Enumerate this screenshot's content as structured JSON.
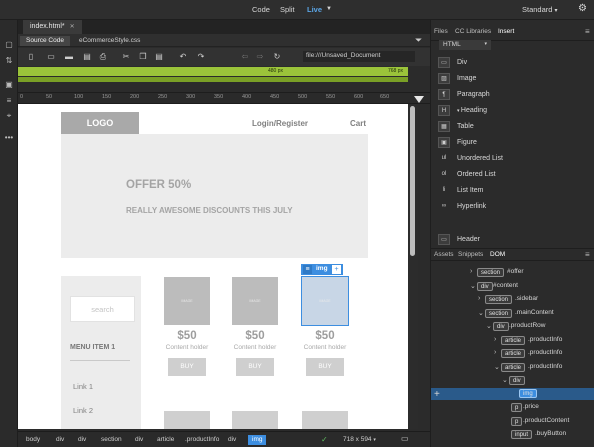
{
  "toolbar": {
    "view_modes": [
      "Code",
      "Split",
      "Live"
    ],
    "live_dropdown": "▼",
    "workspace": "Standard",
    "gear": "⚙"
  },
  "doc": {
    "tab": "index.html*",
    "related_files": [
      "Source Code",
      "eCommerceStyle.css"
    ],
    "url": "file:///Unsaved_Document"
  },
  "media_query": {
    "left_label": "480 px",
    "right_label": "768 px"
  },
  "ruler": {
    "ticks": [
      "0",
      "50",
      "100",
      "150",
      "200",
      "250",
      "300",
      "350",
      "400",
      "450",
      "500",
      "550",
      "600",
      "650"
    ]
  },
  "page": {
    "logo": "LOGO",
    "login": "Login/Register",
    "cart": "Cart",
    "offer_title": "OFFER 50%",
    "offer_subtitle": "REALLY AWESOME DISCOUNTS THIS JULY",
    "search_placeholder": "search",
    "menu_item": "MENU ITEM 1",
    "links": [
      "Link 1",
      "Link 2"
    ],
    "products": [
      {
        "img": "IMAGE",
        "price": "$50",
        "holder": "Content holder",
        "buy": "BUY"
      },
      {
        "img": "IMAGE",
        "price": "$50",
        "holder": "Content holder",
        "buy": "BUY"
      },
      {
        "img": "IMAGE",
        "price": "$50",
        "holder": "Content holder",
        "buy": "BUY"
      }
    ],
    "selected_tag": "img"
  },
  "status": {
    "breadcrumbs": [
      "body",
      "div",
      "div",
      "section",
      "div",
      "article",
      ".productInfo",
      "div",
      "img"
    ],
    "size": "718 x 594"
  },
  "panel": {
    "tabs": [
      "Files",
      "CC Libraries",
      "Insert"
    ],
    "category": "HTML",
    "insert_items": [
      {
        "icon": "div-icon",
        "label": "Div",
        "glyph": "▭"
      },
      {
        "icon": "image-icon",
        "label": "Image",
        "glyph": "▨"
      },
      {
        "icon": "paragraph-icon",
        "label": "Paragraph",
        "glyph": "¶"
      },
      {
        "icon": "heading-icon",
        "label": "Heading",
        "glyph": "H"
      },
      {
        "icon": "table-icon",
        "label": "Table",
        "glyph": "▦"
      },
      {
        "icon": "figure-icon",
        "label": "Figure",
        "glyph": "▣"
      },
      {
        "icon": "unordered-list-icon",
        "label": "Unordered List",
        "glyph": "ul"
      },
      {
        "icon": "ordered-list-icon",
        "label": "Ordered List",
        "glyph": "ol"
      },
      {
        "icon": "list-item-icon",
        "label": "List Item",
        "glyph": "li"
      },
      {
        "icon": "hyperlink-icon",
        "label": "Hyperlink",
        "glyph": "∞"
      },
      {
        "icon": "header-icon",
        "label": "Header",
        "glyph": "▭"
      }
    ],
    "bottom_tabs": [
      "Assets",
      "Snippets",
      "DOM"
    ],
    "dom_tree": [
      {
        "arrow": "›",
        "tag": "section",
        "sel": "#offer"
      },
      {
        "arrow": "⌄",
        "tag": "div",
        "sel": "#content"
      },
      {
        "arrow": "›",
        "tag": "section",
        "sel": ".sidebar"
      },
      {
        "arrow": "⌄",
        "tag": "section",
        "sel": ".mainContent"
      },
      {
        "arrow": "⌄",
        "tag": "div",
        "sel": ".productRow"
      },
      {
        "arrow": "›",
        "tag": "article",
        "sel": ".productInfo"
      },
      {
        "arrow": "›",
        "tag": "article",
        "sel": ".productInfo"
      },
      {
        "arrow": "⌄",
        "tag": "article",
        "sel": ".productInfo"
      },
      {
        "arrow": "⌄",
        "tag": "div",
        "sel": ""
      },
      {
        "arrow": "",
        "tag": "img",
        "sel": ""
      },
      {
        "arrow": "",
        "tag": "p",
        "sel": ".price"
      },
      {
        "arrow": "",
        "tag": "p",
        "sel": ".productContent"
      },
      {
        "arrow": "",
        "tag": "input",
        "sel": ".buyButton"
      }
    ],
    "add_button": "+"
  }
}
